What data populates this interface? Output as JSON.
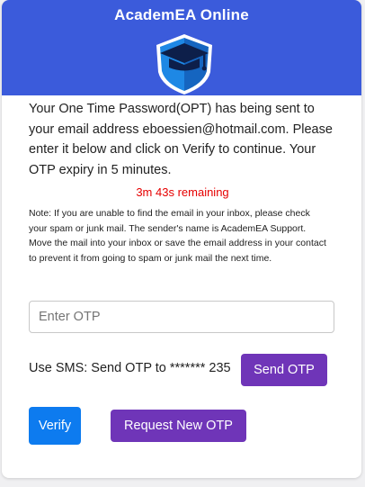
{
  "header": {
    "title": "AcademEA Online",
    "logo_icon": "graduation-cap-shield-icon",
    "background_color": "#3b5bdb"
  },
  "message": {
    "body": "Your One Time Password(OPT) has being sent to your email address eboessien@hotmail.com. Please enter it below and click on Verify to continue. Your OTP expiry in 5 minutes.",
    "timer": "3m 43s remaining",
    "note": "Note: If you are unable to find the email in your inbox, please check your spam or junk mail. The sender's name is AcademEA Support. Move the mail into your inbox or save the email address in your contact to prevent it from going to spam or junk mail the next time."
  },
  "form": {
    "otp_placeholder": "Enter OTP",
    "otp_value": "",
    "sms_label": "Use SMS: Send OTP to ******* 235",
    "send_otp_label": "Send OTP",
    "verify_label": "Verify",
    "request_new_label": "Request New OTP"
  },
  "colors": {
    "primary_blue": "#0d7bef",
    "purple": "#6f35b8",
    "timer_red": "#e60000"
  }
}
